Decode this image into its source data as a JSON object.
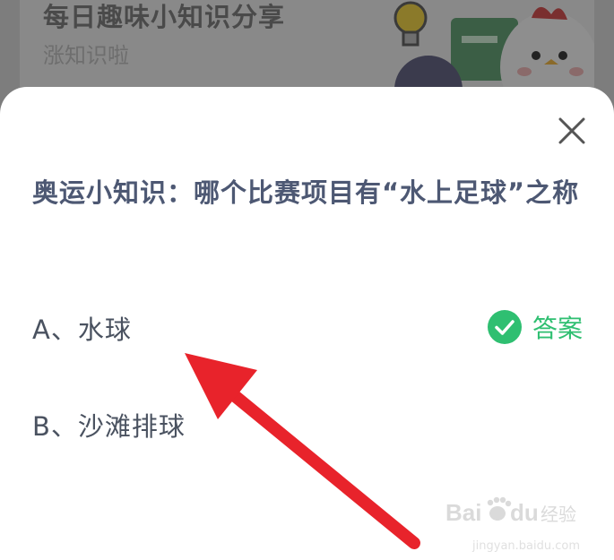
{
  "background_card": {
    "title": "每日趣味小知识分享",
    "subtitle": "涨知识啦"
  },
  "dialog": {
    "close_icon": "close-icon",
    "question": "奥运小知识：哪个比赛项目有“水上足球”之称",
    "options": [
      {
        "label": "A、水球",
        "is_answer": true
      },
      {
        "label": "B、沙滩排球",
        "is_answer": false
      }
    ],
    "answer_label": "答案",
    "answer_icon": "check-circle-icon"
  },
  "watermark": {
    "logo_text": "Bai du 经验",
    "domain": "jingyan.baidu.com"
  },
  "colors": {
    "overlay": "#7d7d7d",
    "question_text": "#4d5873",
    "option_text": "#4a5260",
    "answer_green": "#2fbf71",
    "arrow_red": "#e8232b"
  }
}
